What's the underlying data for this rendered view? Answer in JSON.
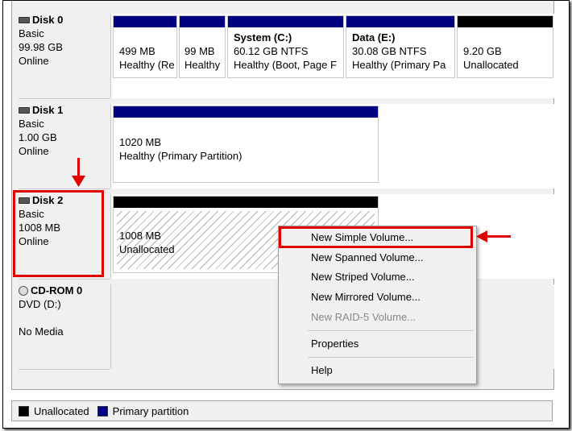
{
  "disks": [
    {
      "name": "Disk 0",
      "type": "Basic",
      "size": "99.98 GB",
      "status": "Online"
    },
    {
      "name": "Disk 1",
      "type": "Basic",
      "size": "1.00 GB",
      "status": "Online"
    },
    {
      "name": "Disk 2",
      "type": "Basic",
      "size": "1008 MB",
      "status": "Online"
    },
    {
      "name": "CD-ROM 0",
      "type": "DVD (D:)",
      "size": "",
      "status": "No Media"
    }
  ],
  "disk0_parts": [
    {
      "title": "",
      "size": "499 MB",
      "status": "Healthy (Re"
    },
    {
      "title": "",
      "size": "99 MB",
      "status": "Healthy"
    },
    {
      "title": "System  (C:)",
      "size": "60.12 GB NTFS",
      "status": "Healthy (Boot, Page F"
    },
    {
      "title": "Data  (E:)",
      "size": "30.08 GB NTFS",
      "status": "Healthy (Primary Pa"
    },
    {
      "title": "",
      "size": "9.20 GB",
      "status": "Unallocated"
    }
  ],
  "disk1_part": {
    "size": "1020 MB",
    "status": "Healthy (Primary Partition)"
  },
  "disk2_part": {
    "size": "1008 MB",
    "status": "Unallocated"
  },
  "menu": {
    "new_simple": "New Simple Volume...",
    "new_spanned": "New Spanned Volume...",
    "new_striped": "New Striped Volume...",
    "new_mirrored": "New Mirrored Volume...",
    "new_raid5": "New RAID-5 Volume...",
    "properties": "Properties",
    "help": "Help"
  },
  "legend": {
    "unallocated": "Unallocated",
    "primary": "Primary partition"
  },
  "colors": {
    "primary": "#000080",
    "unallocated": "#000000",
    "highlight": "#e00000"
  }
}
